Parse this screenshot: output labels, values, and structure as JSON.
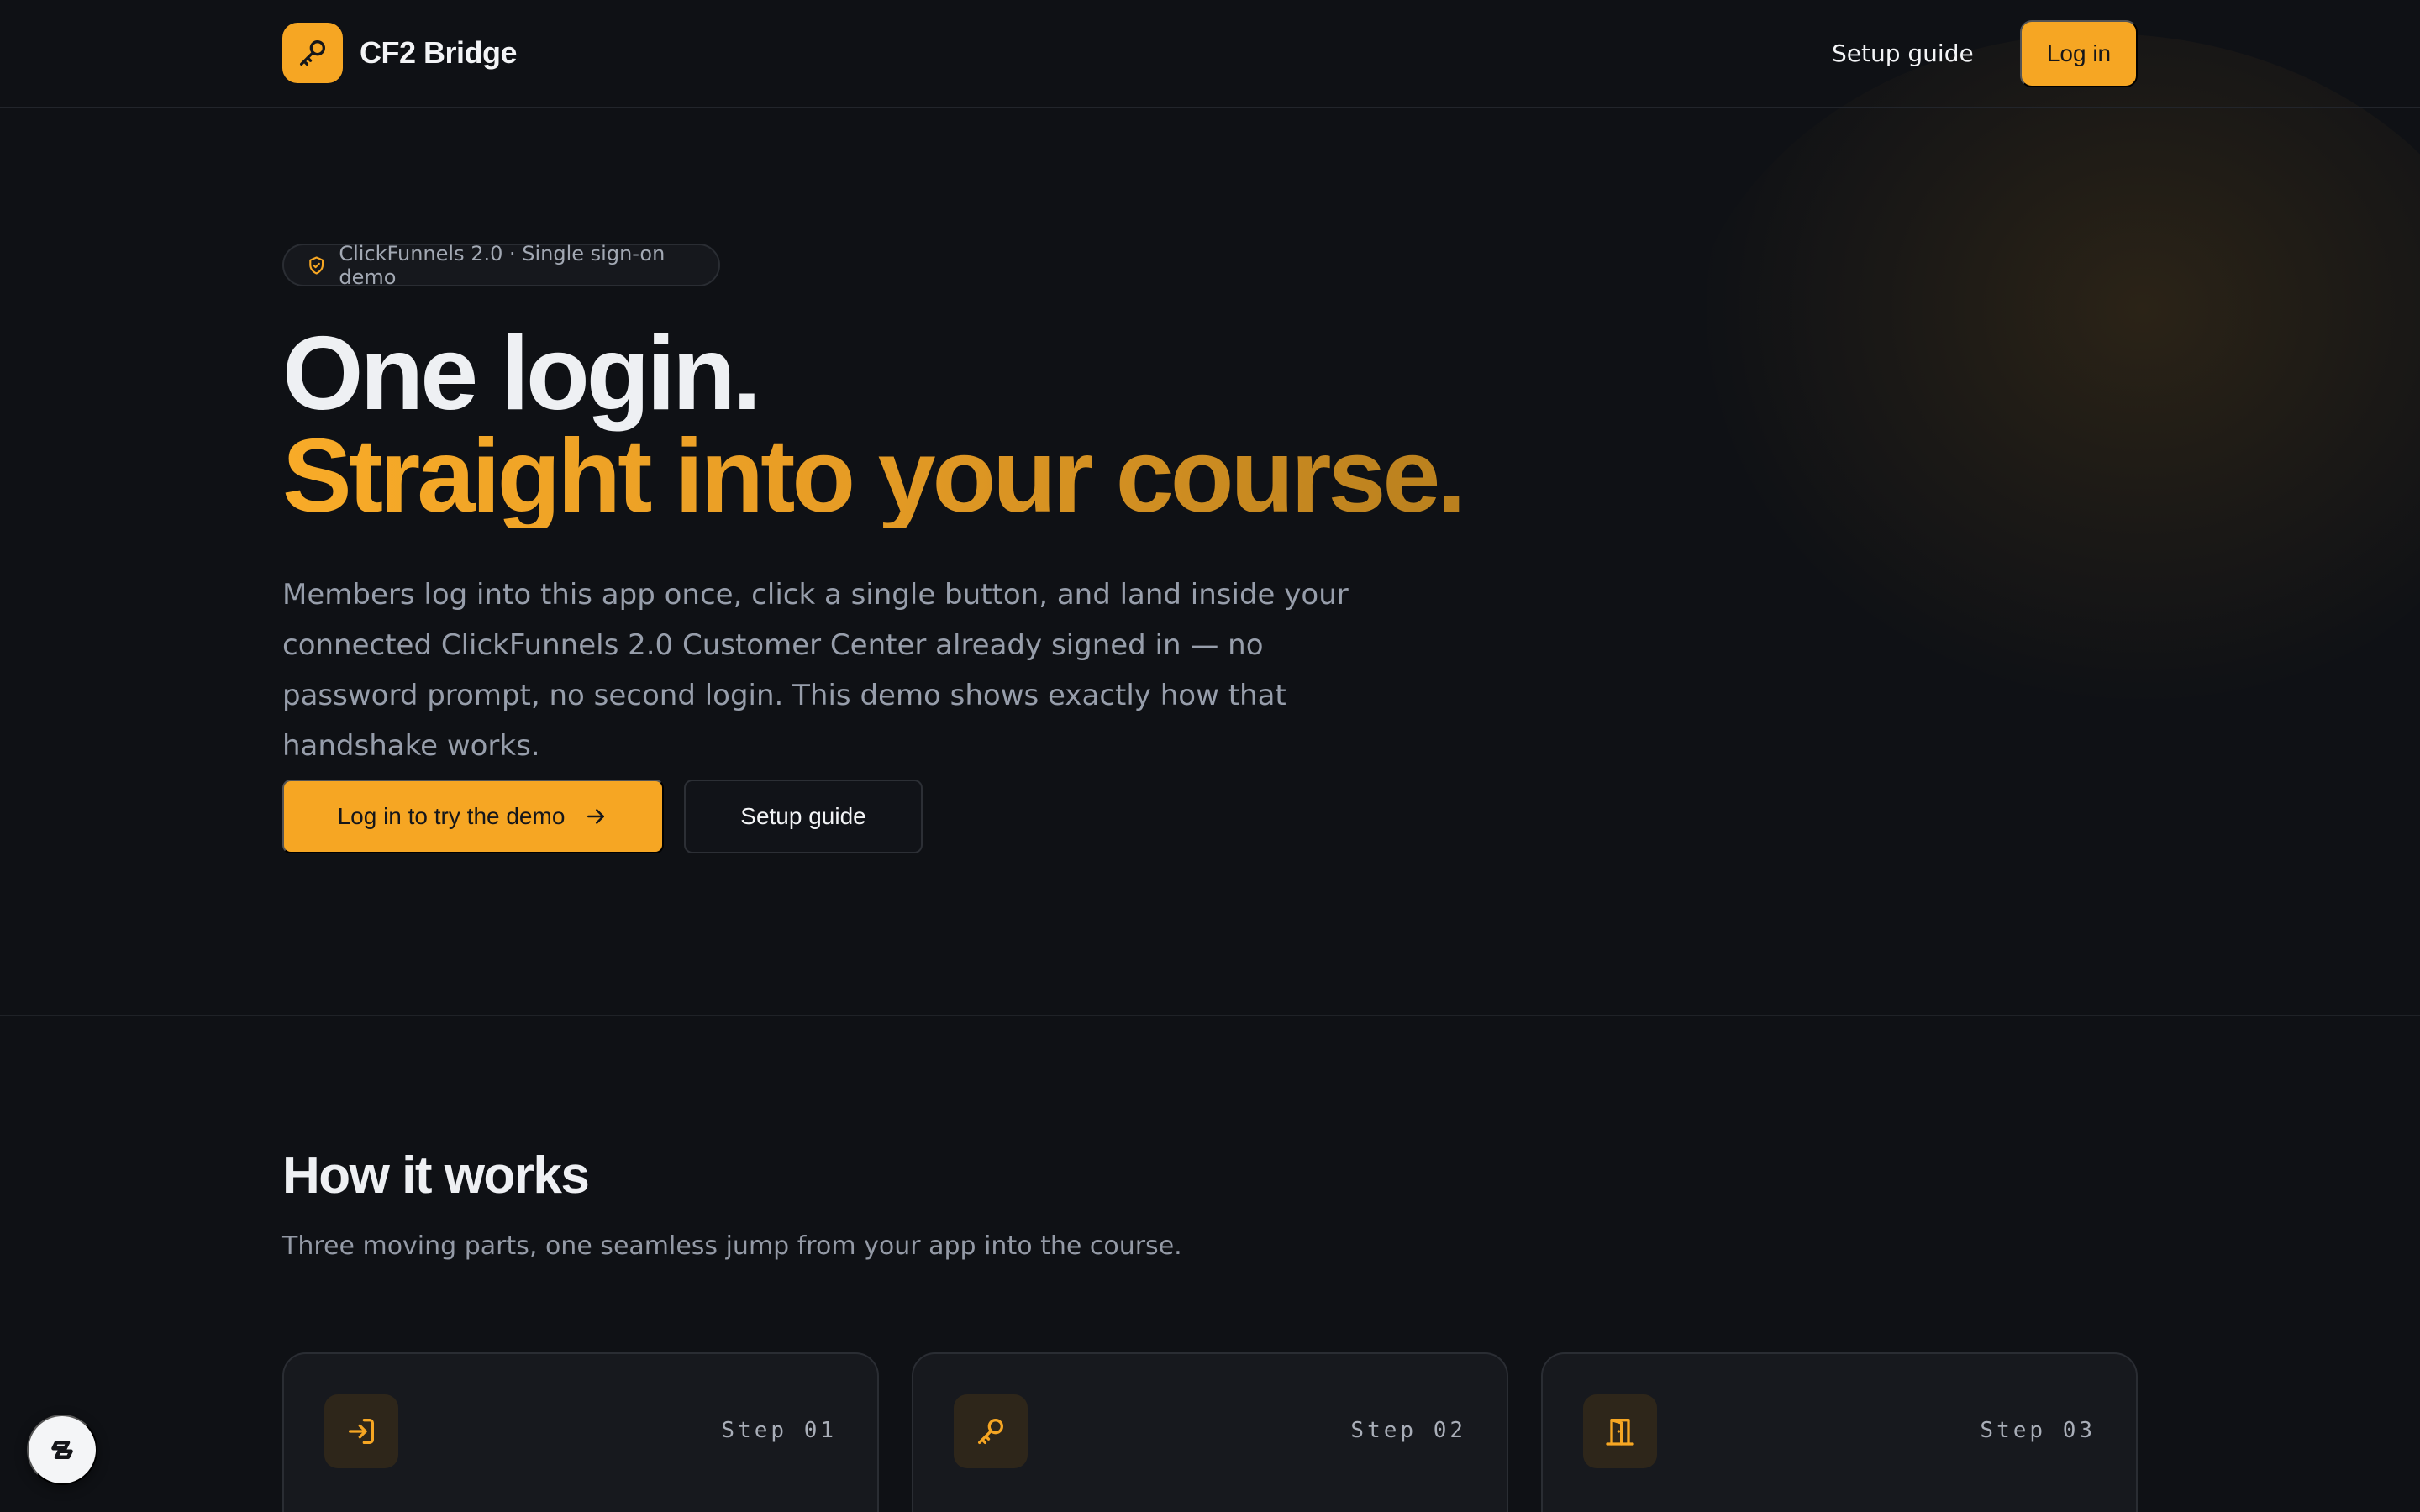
{
  "nav": {
    "brand": "CF2 Bridge",
    "setup_guide": "Setup guide",
    "login": "Log in"
  },
  "hero": {
    "badge": "ClickFunnels 2.0 · Single sign-on demo",
    "title_line1": "One login.",
    "title_line2": "Straight into your course.",
    "lede": "Members log into this app once, click a single button, and land inside your connected ClickFunnels 2.0 Customer Center already signed in — no password prompt, no second login. This demo shows exactly how that handshake works.",
    "cta_primary": "Log in to try the demo",
    "cta_secondary": "Setup guide"
  },
  "how": {
    "title": "How it works",
    "subtitle": "Three moving parts, one seamless jump from your app into the course.",
    "steps": [
      {
        "label": "Step 01",
        "icon": "login-icon"
      },
      {
        "label": "Step 02",
        "icon": "key-icon"
      },
      {
        "label": "Step 03",
        "icon": "door-icon"
      }
    ]
  },
  "colors": {
    "accent": "#f6a623",
    "background": "#0f1115",
    "card": "#17191e"
  }
}
